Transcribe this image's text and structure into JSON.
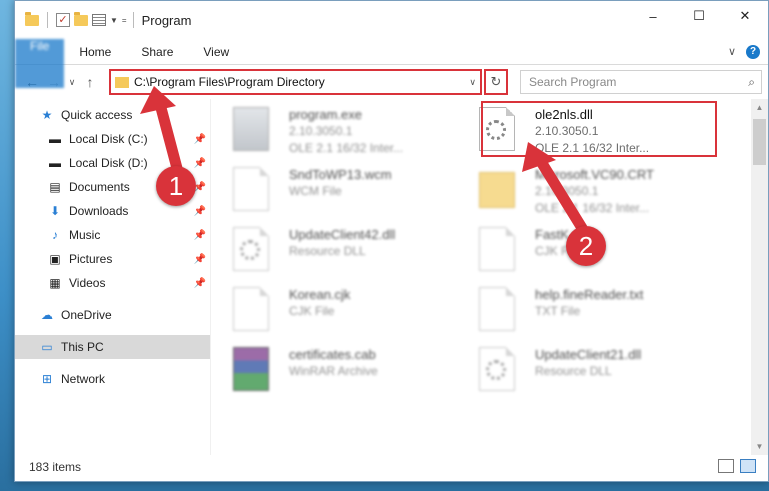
{
  "window": {
    "title": "Program",
    "controls": [
      "–",
      "☐",
      "✕"
    ]
  },
  "ribbon": {
    "tabs": [
      "File",
      "Home",
      "Share",
      "View"
    ]
  },
  "navigation": {
    "address": "C:\\Program Files\\Program Directory",
    "search_placeholder": "Search Program"
  },
  "sidebar": {
    "items": [
      {
        "label": "Quick access",
        "icon": "star-icon"
      },
      {
        "label": "Local Disk (C:)",
        "icon": "drive-icon",
        "pinned": true
      },
      {
        "label": "Local Disk (D:)",
        "icon": "drive-icon",
        "pinned": true
      },
      {
        "label": "Documents",
        "icon": "documents-icon",
        "pinned": true
      },
      {
        "label": "Downloads",
        "icon": "download-arrow-icon",
        "pinned": true
      },
      {
        "label": "Music",
        "icon": "music-note-icon",
        "pinned": true
      },
      {
        "label": "Pictures",
        "icon": "pictures-icon",
        "pinned": true
      },
      {
        "label": "Videos",
        "icon": "film-icon",
        "pinned": true
      },
      {
        "label": "OneDrive",
        "icon": "cloud-icon"
      },
      {
        "label": "This PC",
        "icon": "monitor-icon",
        "selected": true
      },
      {
        "label": "Network",
        "icon": "network-icon"
      }
    ]
  },
  "files": [
    {
      "name": "program.exe",
      "line2": "2.10.3050.1",
      "line3": "OLE 2.1 16/32 Inter...",
      "icon": "exe"
    },
    {
      "name": "ole2nls.dll",
      "line2": "2.10.3050.1",
      "line3": "OLE 2.1 16/32 Inter...",
      "icon": "dll",
      "highlight": true
    },
    {
      "name": "SndToWP13.wcm",
      "line2": "WCM File",
      "line3": "",
      "icon": "doc"
    },
    {
      "name": "Microsoft.VC90.CRT",
      "line2": "2.10.3050.1",
      "line3": "OLE 2.1 16/32 Inter...",
      "icon": "folder"
    },
    {
      "name": "UpdateClient42.dll",
      "line2": "Resource DLL",
      "line3": "",
      "icon": "dll"
    },
    {
      "name": "FastK...",
      "line2": "CJK File",
      "line3": "",
      "icon": "doc"
    },
    {
      "name": "Korean.cjk",
      "line2": "CJK File",
      "line3": "",
      "icon": "doc"
    },
    {
      "name": "help.fineReader.txt",
      "line2": "TXT File",
      "line3": "",
      "icon": "doc"
    },
    {
      "name": "certificates.cab",
      "line2": "WinRAR Archive",
      "line3": "",
      "icon": "cab"
    },
    {
      "name": "UpdateClient21.dll",
      "line2": "Resource DLL",
      "line3": "",
      "icon": "dll"
    }
  ],
  "status": {
    "item_count": "183 items"
  },
  "annotations": {
    "marker1": "1",
    "marker2": "2"
  },
  "colors": {
    "accent": "#1979ca",
    "highlight": "#d9333a"
  }
}
